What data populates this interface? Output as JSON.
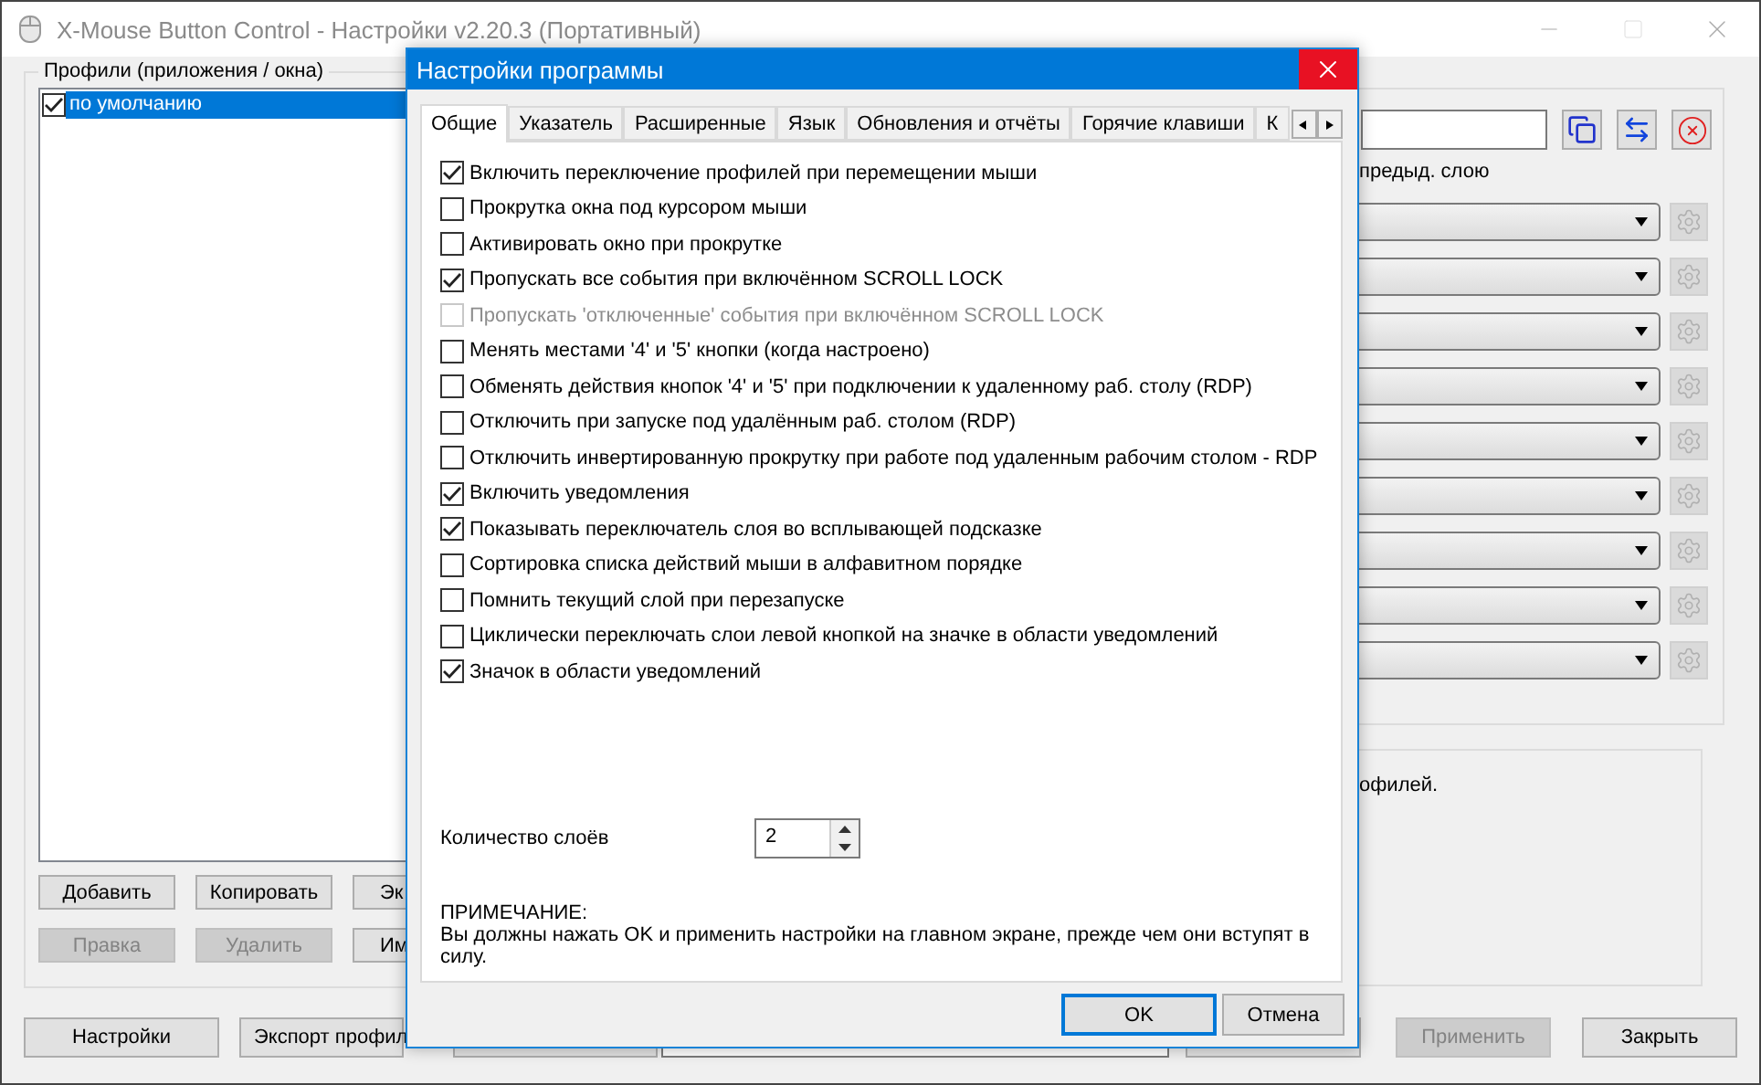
{
  "window": {
    "title": "X-Mouse Button Control - Настройки v2.20.3 (Портативный)"
  },
  "profiles": {
    "label": "Профили (приложения / окна)",
    "items": [
      {
        "label": "по умолчанию",
        "checked": true,
        "selected": true
      }
    ]
  },
  "profile_buttons": [
    {
      "label": "Добавить",
      "disabled": false
    },
    {
      "label": "Копировать",
      "disabled": false
    },
    {
      "label": "Эк",
      "disabled": false
    },
    {
      "label": "Правка",
      "disabled": true
    },
    {
      "label": "Удалить",
      "disabled": true
    },
    {
      "label": "Им",
      "disabled": false
    }
  ],
  "layer_panel": {
    "caption": "предыд. слою",
    "mappings": [
      {
        "settings_disabled": true
      },
      {
        "settings_disabled": true
      },
      {
        "settings_disabled": true
      },
      {
        "settings_disabled": true
      },
      {
        "settings_disabled": true
      },
      {
        "settings_disabled": true
      },
      {
        "settings_disabled": true
      },
      {
        "settings_disabled": true
      },
      {
        "settings_disabled": true
      }
    ]
  },
  "info_text": "офилей.",
  "bottom_buttons": [
    {
      "label": "Настройки",
      "disabled": false
    },
    {
      "label": "Экспорт профил",
      "disabled": false
    },
    {
      "label": "Применить",
      "disabled": true
    },
    {
      "label": "Закрыть",
      "disabled": false
    }
  ],
  "dialog": {
    "title": "Настройки программы",
    "tabs": [
      {
        "label": "Общие",
        "selected": true
      },
      {
        "label": "Указатель",
        "selected": false
      },
      {
        "label": "Расширенные",
        "selected": false
      },
      {
        "label": "Язык",
        "selected": false
      },
      {
        "label": "Обновления и отчёты",
        "selected": false
      },
      {
        "label": "Горячие клавиши",
        "selected": false
      },
      {
        "label": "К",
        "selected": false
      }
    ],
    "options": [
      {
        "label": "Включить переключение профилей при перемещении мыши",
        "checked": true,
        "disabled": false
      },
      {
        "label": "Прокрутка окна под курсором мыши",
        "checked": false,
        "disabled": false
      },
      {
        "label": "Активировать окно при прокрутке",
        "checked": false,
        "disabled": false
      },
      {
        "label": "Пропускать все события при включённом SCROLL LOCK",
        "checked": true,
        "disabled": false
      },
      {
        "label": "Пропускать 'отключенные' события при включённом SCROLL LOCK",
        "checked": false,
        "disabled": true
      },
      {
        "label": "Менять местами '4' и '5' кнопки (когда настроено)",
        "checked": false,
        "disabled": false
      },
      {
        "label": "Обменять действия кнопок '4' и '5' при подключении к удаленному раб. столу (RDP)",
        "checked": false,
        "disabled": false
      },
      {
        "label": "Отключить при запуске под удалённым раб. столом (RDP)",
        "checked": false,
        "disabled": false
      },
      {
        "label": "Отключить инвертированную прокрутку при работе под удаленным рабочим столом - RDP",
        "checked": false,
        "disabled": false
      },
      {
        "label": "Включить уведомления",
        "checked": true,
        "disabled": false
      },
      {
        "label": "Показывать переключатель слоя во всплывающей подсказке",
        "checked": true,
        "disabled": false
      },
      {
        "label": "Сортировка списка действий мыши в алфавитном порядке",
        "checked": false,
        "disabled": false
      },
      {
        "label": "Помнить текущий слой при перезапуске",
        "checked": false,
        "disabled": false
      },
      {
        "label": "Циклически переключать слои левой кнопкой на значке в области уведомлений",
        "checked": false,
        "disabled": false
      },
      {
        "label": "Значок в области уведомлений",
        "checked": true,
        "disabled": false
      }
    ],
    "layers": {
      "label": "Количество слоёв",
      "value": "2"
    },
    "note": {
      "heading": "ПРИМЕЧАНИЕ:",
      "text": "Вы должны нажать OK и применить настройки на главном экране, прежде чем они вступят в силу."
    },
    "buttons": [
      {
        "label": "OK",
        "default": true
      },
      {
        "label": "Отмена",
        "default": false
      }
    ]
  }
}
